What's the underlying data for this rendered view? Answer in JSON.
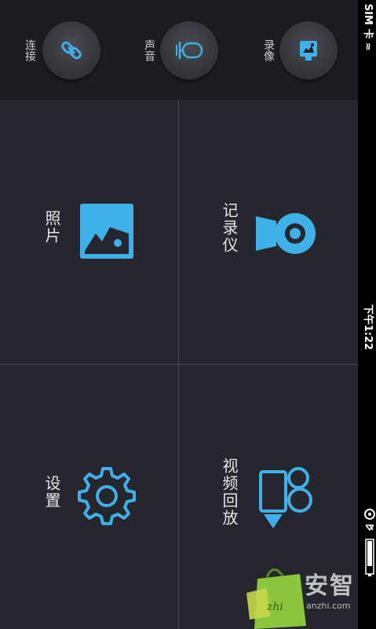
{
  "status_bar": {
    "carrier": "无 SIM 卡 ≈",
    "time": "下午1:22",
    "icons": [
      "location-icon",
      "bluetooth-icon",
      "battery-icon"
    ]
  },
  "toolbar": {
    "buttons": [
      {
        "label": "录像",
        "icon": "video-record-icon"
      },
      {
        "label": "声音",
        "icon": "microphone-icon"
      },
      {
        "label": "连接",
        "icon": "link-icon"
      }
    ]
  },
  "grid": {
    "tiles": [
      {
        "label": "记录仪",
        "icon": "webcam-icon"
      },
      {
        "label": "照片",
        "icon": "image-icon"
      },
      {
        "label": "视频回放",
        "icon": "video-camera-icon"
      },
      {
        "label": "设置",
        "icon": "gear-icon"
      }
    ]
  },
  "colors": {
    "accent": "#3fb0e8",
    "background": "#26262e",
    "toolbar": "#1c1c22",
    "divider": "#4a4a55"
  },
  "watermark": {
    "text": "安智",
    "sub": "anzhi.com"
  }
}
